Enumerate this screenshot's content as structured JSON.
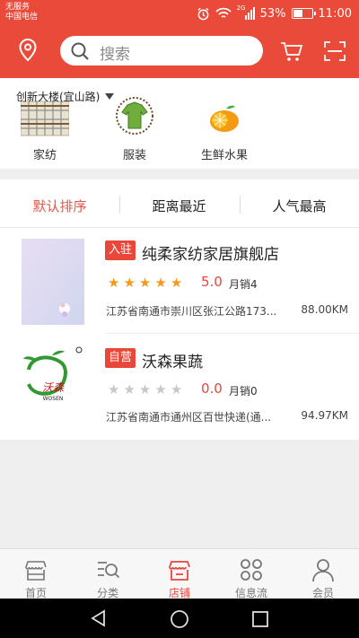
{
  "status_bar": {
    "carrier_line1": "无服务",
    "carrier_line2": "中国电信",
    "network_label": "2G",
    "battery_percent": "53%",
    "battery_level": 0.53,
    "time": "11:00",
    "icons": [
      "alarm-icon",
      "wifi-icon",
      "signal-icon",
      "battery-icon"
    ]
  },
  "header": {
    "search_placeholder": "搜索",
    "icons": [
      "location-pin-icon",
      "search-icon",
      "cart-icon",
      "scan-icon"
    ],
    "accent_color": "#ea4a3a"
  },
  "location": {
    "label": "创新大楼(宜山路)"
  },
  "categories": [
    {
      "label": "家纺"
    },
    {
      "label": "服装"
    },
    {
      "label": "生鲜水果"
    }
  ],
  "sort_tabs": [
    {
      "label": "默认排序",
      "active": true
    },
    {
      "label": "距离最近",
      "active": false
    },
    {
      "label": "人气最高",
      "active": false
    }
  ],
  "stores": [
    {
      "tag": "入驻",
      "name": "纯柔家纺家居旗舰店",
      "rating": "5.0",
      "stars_filled": 5,
      "sales": "月销4",
      "address": "江苏省南通市崇川区张江公路173...",
      "distance": "88.00KM"
    },
    {
      "tag": "自营",
      "name": "沃森果蔬",
      "rating": "0.0",
      "stars_filled": 0,
      "sales": "月销0",
      "address": "江苏省南通市通州区百世快递(通...",
      "distance": "94.97KM",
      "logo_text": "沃森",
      "logo_subtext": "WOSEN"
    }
  ],
  "tab_bar": [
    {
      "label": "首页",
      "icon": "home-store-icon",
      "active": false
    },
    {
      "label": "分类",
      "icon": "category-search-icon",
      "active": false
    },
    {
      "label": "店铺",
      "icon": "shop-icon",
      "active": true
    },
    {
      "label": "信息流",
      "icon": "feed-icon",
      "active": false
    },
    {
      "label": "会员",
      "icon": "member-icon",
      "active": false
    }
  ],
  "nav_bar": {
    "icons": [
      "back-icon",
      "home-icon",
      "recents-icon"
    ]
  },
  "colors": {
    "accent": "#e8473a",
    "star_on": "#f39a1b",
    "star_off": "#c8c8c8"
  }
}
